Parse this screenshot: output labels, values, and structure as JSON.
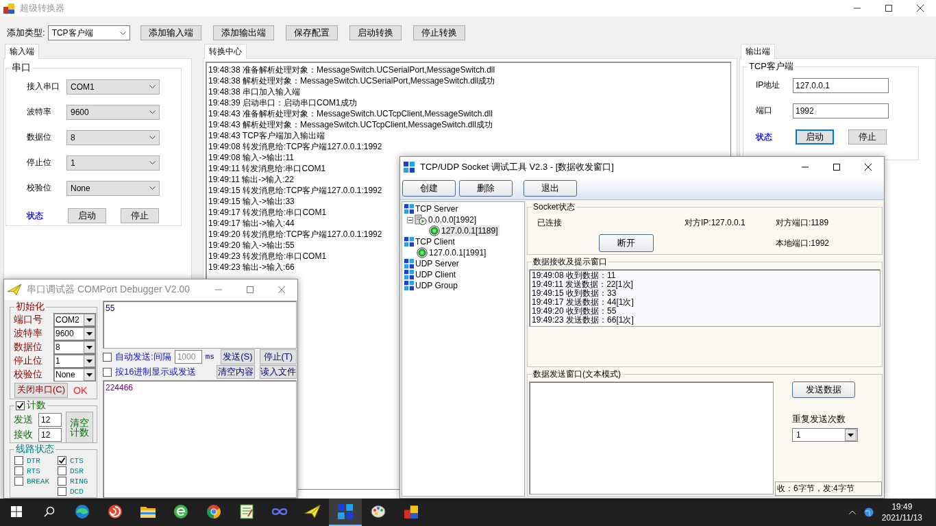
{
  "main_window": {
    "title": "超级转换器"
  },
  "toolbar": {
    "type_label": "添加类型:",
    "type_value": "TCP客户端",
    "buttons": [
      "添加输入端",
      "添加输出端",
      "保存配置",
      "启动转换",
      "停止转换"
    ]
  },
  "input_panel": {
    "tab": "输入端",
    "group_title": "串口",
    "fields": [
      {
        "label": "接入串口",
        "value": "COM1"
      },
      {
        "label": "波特率",
        "value": "9600"
      },
      {
        "label": "数据位",
        "value": "8"
      },
      {
        "label": "停止位",
        "value": "1"
      },
      {
        "label": "校验位",
        "value": "None"
      }
    ],
    "status_label": "状态",
    "buttons": [
      {
        "label": "启动",
        "focused": false
      },
      {
        "label": "停止",
        "focused": false
      }
    ]
  },
  "center_panel": {
    "tab": "转换中心",
    "log": [
      "19:48:38 准备解析处理对象：MessageSwitch.UCSerialPort,MessageSwitch.dll",
      "19:48:38 解析处理对象：MessageSwitch.UCSerialPort,MessageSwitch.dll成功",
      "19:48:38 串口加入输入端",
      "19:48:39 启动串口：启动串口COM1成功",
      "19:48:43 准备解析处理对象：MessageSwitch.UCTcpClient,MessageSwitch.dll",
      "19:48:43 解析处理对象：MessageSwitch.UCTcpClient,MessageSwitch.dll成功",
      "19:48:43 TCP客户端加入输出端",
      "19:49:08 转发消息给:TCP客户端127.0.0.1:1992",
      "19:49:08 输入->输出:11",
      "19:49:11 转发消息给:串口COM1",
      "19:49:11 输出->输入:22",
      "19:49:15 转发消息给:TCP客户端127.0.0.1:1992",
      "19:49:15 输入->输出:33",
      "19:49:17 转发消息给:串口COM1",
      "19:49:17 输出->输入:44",
      "19:49:20 转发消息给:TCP客户端127.0.0.1:1992",
      "19:49:20 输入->输出:55",
      "19:49:23 转发消息给:串口COM1",
      "19:49:23 输出->输入:66"
    ]
  },
  "output_panel": {
    "tab": "输出端",
    "group_title": "TCP客户端",
    "fields": [
      {
        "label": "IP地址",
        "value": "127.0.0.1"
      },
      {
        "label": "端口",
        "value": "1992"
      }
    ],
    "status_label": "状态",
    "buttons": [
      {
        "label": "启动",
        "focused": true
      },
      {
        "label": "停止",
        "focused": false
      }
    ]
  },
  "com_debugger": {
    "title": "串口调试器 COMPort Debugger V2.00",
    "init_group": {
      "title": "初始化",
      "fields": [
        {
          "label": "端口号",
          "value": "COM2"
        },
        {
          "label": "波特率",
          "value": "9600"
        },
        {
          "label": "数据位",
          "value": "8"
        },
        {
          "label": "停止位",
          "value": "1"
        },
        {
          "label": "校验位",
          "value": "None"
        }
      ],
      "close_button": "关闭串口(C)",
      "status": "OK"
    },
    "count_group": {
      "title": "计数",
      "checked": true,
      "rows": [
        {
          "label": "发送",
          "value": "12"
        },
        {
          "label": "接收",
          "value": "12"
        }
      ],
      "clear_button": "清空计数"
    },
    "line_status": {
      "title": "线路状态",
      "left": [
        {
          "label": "DTR",
          "checked": false
        },
        {
          "label": "RTS",
          "checked": false
        },
        {
          "label": "BREAK",
          "checked": false
        }
      ],
      "right": [
        {
          "label": "CTS",
          "checked": true
        },
        {
          "label": "DSR",
          "checked": false
        },
        {
          "label": "RING",
          "checked": false
        },
        {
          "label": "DCD",
          "checked": false
        }
      ]
    },
    "send_text": "55",
    "auto_send": {
      "label": "自动发送:间隔",
      "checked": false,
      "interval": "1000",
      "unit": "ms",
      "buttons": [
        "发送(S)",
        "停止(T)"
      ]
    },
    "hex_mode": {
      "label": "按16进制显示或发送",
      "checked": false,
      "buttons": [
        "清空内容",
        "读入文件"
      ]
    },
    "receive_text": "224466"
  },
  "socket_tool": {
    "title": "TCP/UDP Socket 调试工具 V2.3 - [数据收发窗口]",
    "buttons": [
      "创建",
      "删除",
      "退出"
    ],
    "tree": [
      {
        "label": "TCP Server",
        "kind": "category",
        "selected": false,
        "children": [
          {
            "label": "0.0.0.0[1992]",
            "kind": "server",
            "selected": false,
            "expanded": true,
            "children": [
              {
                "label": "127.0.0.1[1189]",
                "kind": "connection",
                "selected": true
              }
            ]
          }
        ]
      },
      {
        "label": "TCP Client",
        "kind": "category",
        "selected": false,
        "children": [
          {
            "label": "127.0.0.1[1991]",
            "kind": "connection",
            "selected": false
          }
        ]
      },
      {
        "label": "UDP Server",
        "kind": "category",
        "selected": false
      },
      {
        "label": "UDP Client",
        "kind": "category",
        "selected": false
      },
      {
        "label": "UDP Group",
        "kind": "category",
        "selected": false
      }
    ],
    "status_group": {
      "title": "Socket状态",
      "state": "已连接",
      "remote_ip": "对方IP:127.0.0.1",
      "remote_port": "对方端口:1189",
      "disconnect_button": "断开",
      "local_port": "本地端口:1992"
    },
    "receive_group": {
      "title": "数据接收及提示窗口",
      "lines": [
        "19:49:08 收到数据：11",
        "19:49:11 发送数据：22[1次]",
        "19:49:15 收到数据：33",
        "19:49:17 发送数据：44[1次]",
        "19:49:20 收到数据：55",
        "19:49:23 发送数据：66[1次]"
      ]
    },
    "send_group": {
      "title": "数据发送窗口(文本模式)",
      "send_button": "发送数据",
      "repeat_label": "重复发送次数",
      "repeat_value": "1",
      "counter": "收：6字节，发:4字节"
    }
  },
  "taskbar": {
    "apps": [
      {
        "active": false
      },
      {
        "active": false
      },
      {
        "active": false
      },
      {
        "active": false
      },
      {
        "active": false
      },
      {
        "active": false
      },
      {
        "active": false
      },
      {
        "active": false
      },
      {
        "active": true
      },
      {
        "active": false
      },
      {
        "active": false
      }
    ],
    "time": "19:49",
    "date": "2021/11/13"
  }
}
